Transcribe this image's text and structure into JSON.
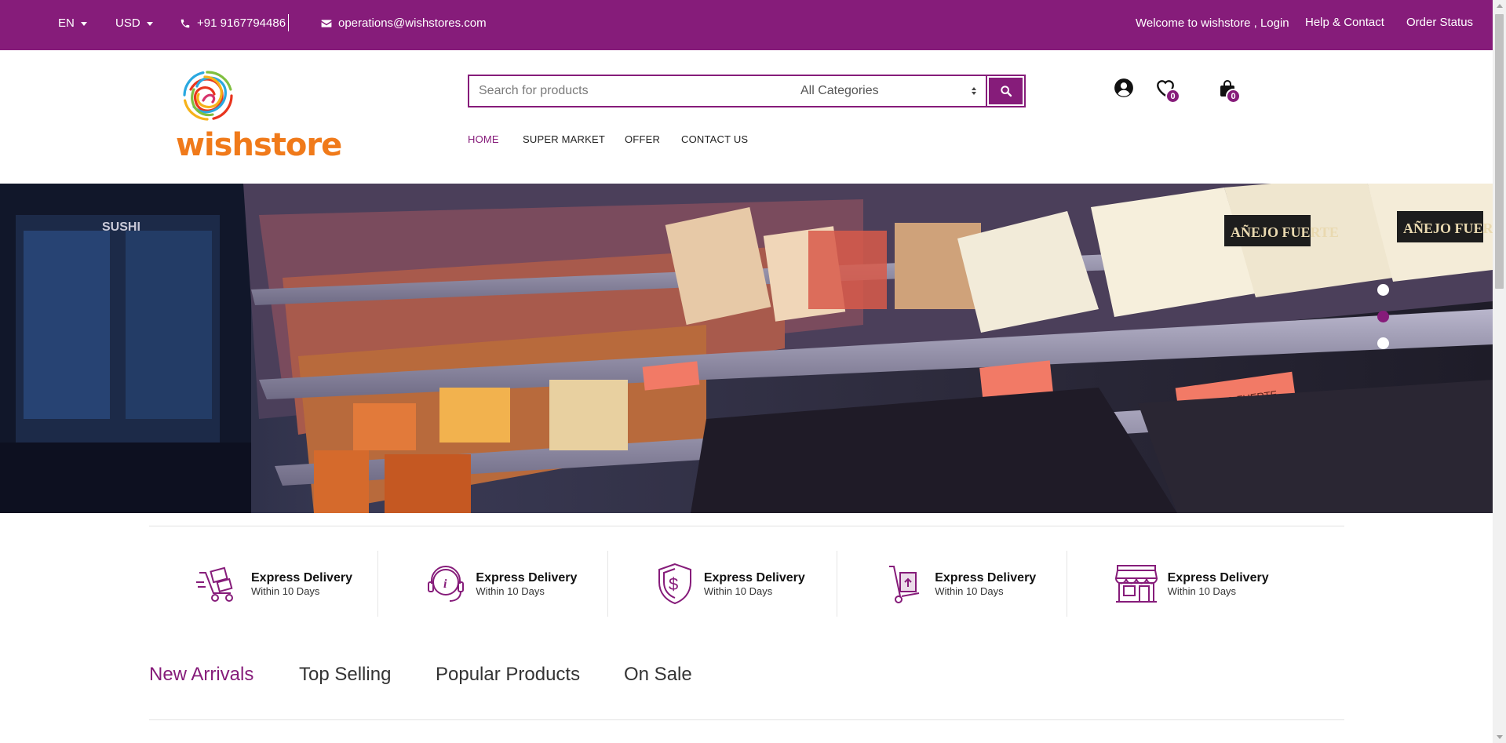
{
  "topbar": {
    "language": "EN",
    "currency": "USD",
    "phone": "+91 9167794486",
    "email": "operations@wishstores.com",
    "welcome": "Welcome to wishstore , Login",
    "help": "Help & Contact",
    "order_status": "Order Status",
    "bg_color": "#861c7a"
  },
  "header": {
    "logo_text": "wishstore",
    "search": {
      "placeholder": "Search for products",
      "category": "All Categories"
    },
    "nav": [
      "HOME",
      "SUPER MARKET",
      "OFFER",
      "CONTACT US"
    ],
    "wishlist_count": "0",
    "cart_count": "0"
  },
  "hero": {
    "slides": 3,
    "active_slide": 2,
    "shelf_labels": [
      "SUSHI",
      "AÑEJO FUERTE",
      "AÑEJO FUERTE",
      "QUESO FUERTE"
    ]
  },
  "features": [
    {
      "title": "Express Delivery",
      "subtitle": "Within 10 Days",
      "icon": "delivery-cart-icon"
    },
    {
      "title": "Express Delivery",
      "subtitle": "Within 10 Days",
      "icon": "info-headset-icon"
    },
    {
      "title": "Express Delivery",
      "subtitle": "Within 10 Days",
      "icon": "dollar-shield-icon"
    },
    {
      "title": "Express Delivery",
      "subtitle": "Within 10 Days",
      "icon": "hand-truck-icon"
    },
    {
      "title": "Express Delivery",
      "subtitle": "Within 10 Days",
      "icon": "storefront-icon"
    }
  ],
  "tabs": [
    "New Arrivals",
    "Top Selling",
    "Popular Products",
    "On Sale"
  ],
  "colors": {
    "accent": "#861c7a",
    "logo_orange": "#f07a1a"
  }
}
